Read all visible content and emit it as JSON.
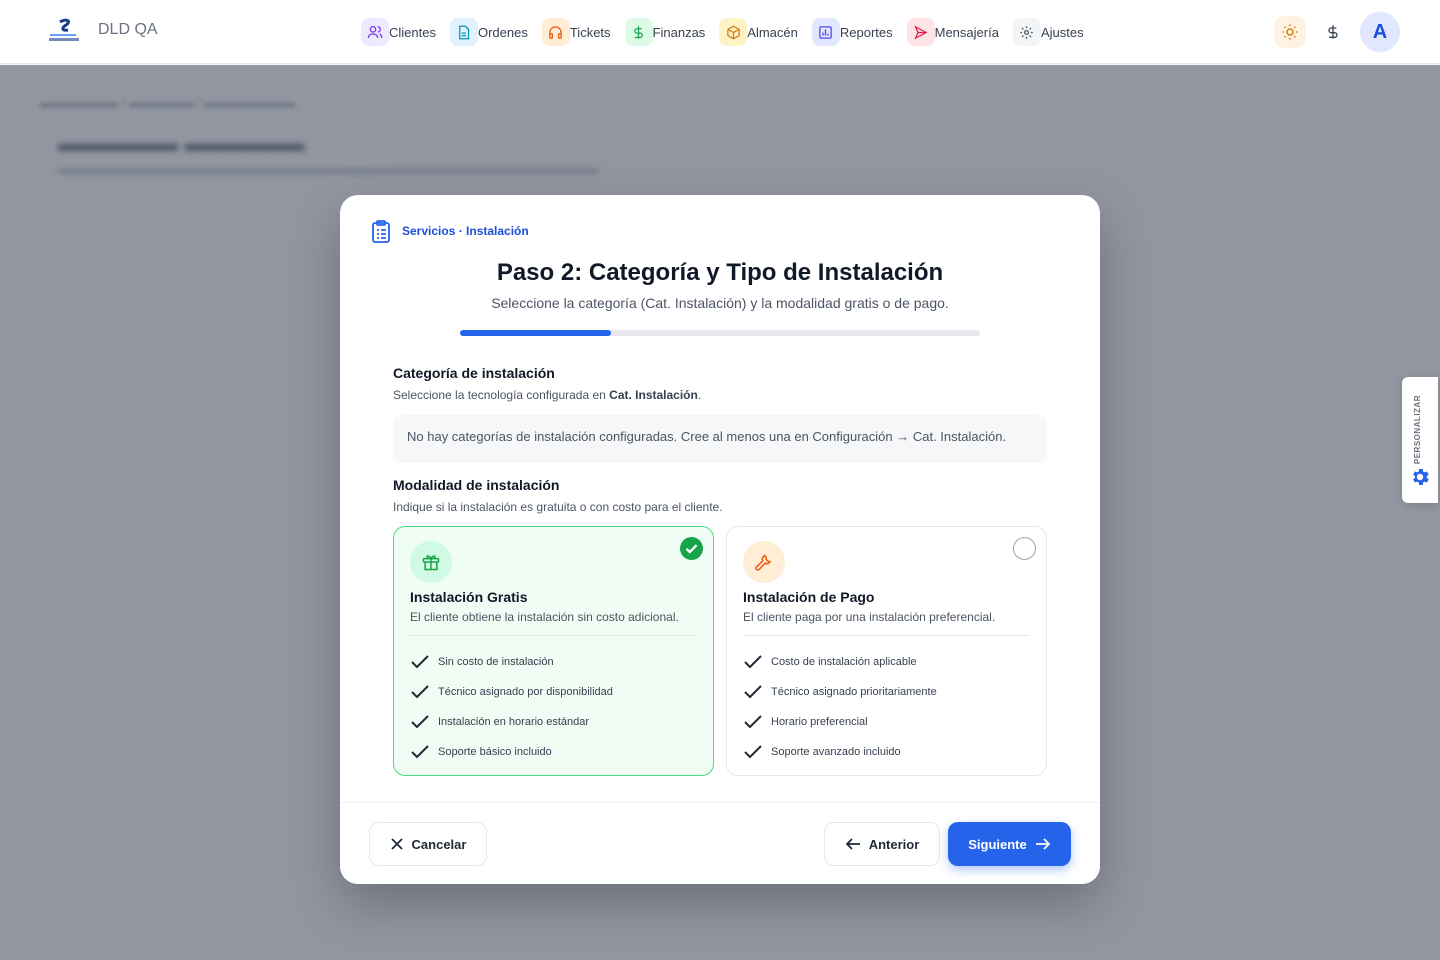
{
  "app": {
    "brand": "DLD QA"
  },
  "nav": {
    "items": [
      {
        "label": "Clientes",
        "icon": "users-icon",
        "bg": "#ede9fe",
        "color": "#7c3aed"
      },
      {
        "label": "Ordenes",
        "icon": "document-icon",
        "bg": "#e0f2fe",
        "color": "#0891b2"
      },
      {
        "label": "Tickets",
        "icon": "headset-icon",
        "bg": "#ffedd5",
        "color": "#ea580c"
      },
      {
        "label": "Finanzas",
        "icon": "dollar-icon",
        "bg": "#dcfce7",
        "color": "#16a34a"
      },
      {
        "label": "Almacén",
        "icon": "box-icon",
        "bg": "#fef3c7",
        "color": "#d97706"
      },
      {
        "label": "Reportes",
        "icon": "bar-chart-icon",
        "bg": "#e0e7ff",
        "color": "#4f46e5"
      },
      {
        "label": "Mensajería",
        "icon": "send-icon",
        "bg": "#ffe4e6",
        "color": "#e11d48"
      },
      {
        "label": "Ajustes",
        "icon": "gear-icon",
        "bg": "#f3f4f6",
        "color": "#4b5563"
      }
    ]
  },
  "user": {
    "avatar_initial": "A"
  },
  "side_tab": {
    "label": "PERSONALIZAR"
  },
  "modal": {
    "breadcrumb": "Servicios · Instalación",
    "title": "Paso 2: Categoría y Tipo de Instalación",
    "subtitle": "Seleccione la categoría (Cat. Instalación) y la modalidad gratis o de pago.",
    "progress": 0.29,
    "category": {
      "title": "Categoría de instalación",
      "desc_prefix": "Seleccione la tecnología configurada en ",
      "desc_bold": "Cat. Instalación",
      "desc_suffix": ".",
      "empty": "No hay categorías de instalación configuradas. Cree al menos una en Configuración → Cat. Instalación."
    },
    "modality": {
      "title": "Modalidad de instalación",
      "desc": "Indique si la instalación es gratuita o con costo para el cliente.",
      "options": [
        {
          "title": "Instalación Gratis",
          "desc": "El cliente obtiene la instalación sin costo adicional.",
          "selected": true,
          "features": [
            "Sin costo de instalación",
            "Técnico asignado por disponibilidad",
            "Instalación en horario estándar",
            "Soporte básico incluido"
          ]
        },
        {
          "title": "Instalación de Pago",
          "desc": "El cliente paga por una instalación preferencial.",
          "selected": false,
          "features": [
            "Costo de instalación aplicable",
            "Técnico asignado prioritariamente",
            "Horario preferencial",
            "Soporte avanzado incluido"
          ]
        }
      ]
    },
    "footer": {
      "cancel": "Cancelar",
      "previous": "Anterior",
      "next": "Siguiente"
    }
  },
  "colors": {
    "accent": "#2563eb",
    "success": "#16a34a",
    "overlay": "#6b7280"
  }
}
